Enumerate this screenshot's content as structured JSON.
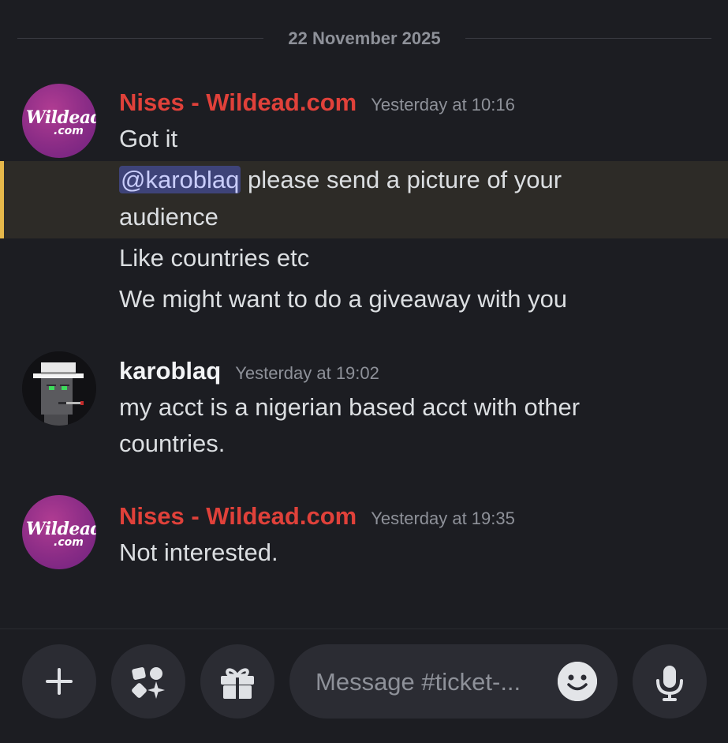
{
  "date_divider": "22 November 2025",
  "messages": [
    {
      "author": "Nises - Wildead.com",
      "timestamp": "Yesterday at 10:16",
      "avatar": {
        "line1": "Wildead",
        "line2": ".com"
      },
      "lines": {
        "l1": "Got it",
        "mention": "@karoblaq",
        "l2_rest": " please send a picture of your",
        "l3": "audience",
        "l4": "Like countries etc",
        "l5": "We might want to do a giveaway with you"
      }
    },
    {
      "author": "karoblaq",
      "timestamp": "Yesterday at 19:02",
      "lines": {
        "l1": "my acct is a nigerian based acct with other",
        "l2": "countries."
      }
    },
    {
      "author": "Nises - Wildead.com",
      "timestamp": "Yesterday at 19:35",
      "avatar": {
        "line1": "Wildead",
        "line2": ".com"
      },
      "lines": {
        "l1": "Not interested."
      }
    }
  ],
  "composer": {
    "placeholder": "Message #ticket-...",
    "icons": [
      "plus-icon",
      "apps-icon",
      "gift-icon",
      "emoji-icon",
      "microphone-icon"
    ]
  },
  "colors": {
    "background": "#1c1d22",
    "author_red": "#e0413a",
    "mention_bg": "#3e4378",
    "highlight_bar": "#e6b84a"
  }
}
